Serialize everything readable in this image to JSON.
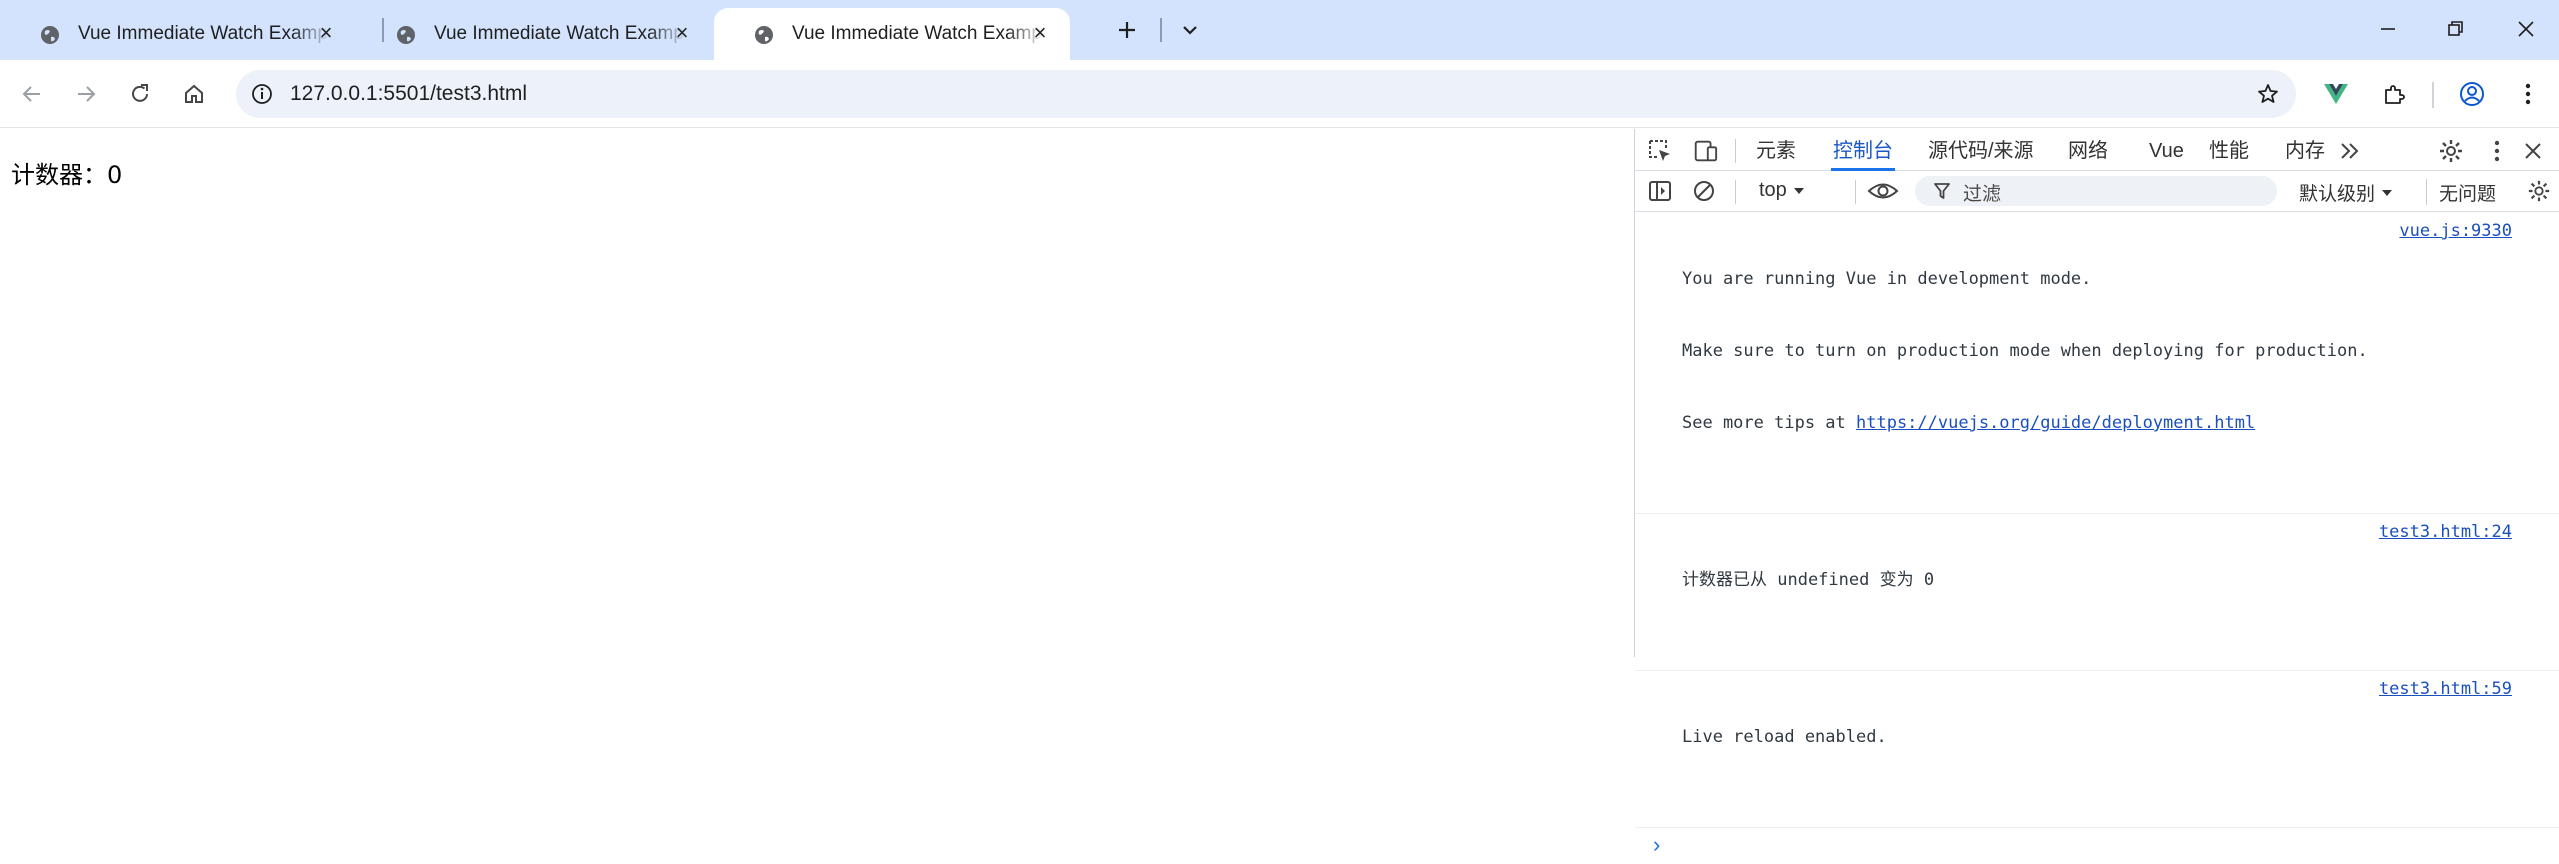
{
  "browser": {
    "tabs": [
      {
        "title": "Vue Immediate Watch Example",
        "active": false,
        "icon": "globe-icon"
      },
      {
        "title": "Vue Immediate Watch Example",
        "active": false,
        "icon": "globe-icon"
      },
      {
        "title": "Vue Immediate Watch Example",
        "active": true,
        "icon": "globe-icon"
      }
    ],
    "new_tab_icon": "plus-icon",
    "tab_search_icon": "chevron-down-icon",
    "window_controls": [
      "minimize-icon",
      "restore-icon",
      "close-icon"
    ],
    "address": "127.0.0.1:5501/test3.html",
    "accent": "#d3e3fd"
  },
  "page": {
    "counter_text": "计数器：0"
  },
  "devtools": {
    "tabs": [
      "元素",
      "控制台",
      "源代码/来源",
      "网络",
      "Vue",
      "性能",
      "内存"
    ],
    "active_tab": "控制台",
    "context": "top",
    "filter_placeholder": "过滤",
    "level": "默认级别",
    "issues": "无问题",
    "messages": [
      {
        "lines": [
          "You are running Vue in development mode.",
          "Make sure to turn on production mode when deploying for production.",
          "See more tips at "
        ],
        "link": "https://vuejs.org/guide/deployment.html",
        "source": "vue.js:9330"
      },
      {
        "text": "计数器已从 undefined 变为 0",
        "source": "test3.html:24"
      },
      {
        "text": "Live reload enabled.",
        "source": "test3.html:59"
      }
    ],
    "prompt": "›"
  }
}
